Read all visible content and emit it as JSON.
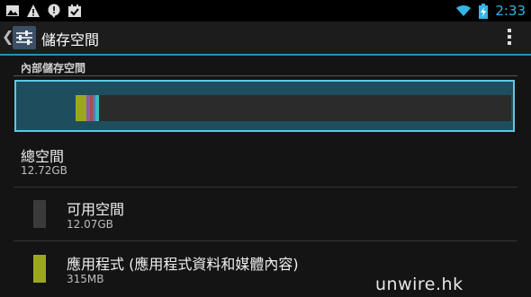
{
  "status_bar": {
    "time": "2:33",
    "icons_left": [
      "image-notification-icon",
      "warning-icon",
      "alert-icon",
      "download-done-icon"
    ],
    "icons_right": [
      "wifi-icon",
      "battery-charging-icon"
    ],
    "accent_color": "#33b5e5"
  },
  "action_bar": {
    "title": "儲存空間",
    "back_icon": "chevron-left-icon",
    "app_icon": "settings-sliders-icon",
    "menu_icon": "overflow-menu-icon"
  },
  "internal_storage": {
    "section_title": "內部儲存空間",
    "usage_bar": {
      "segments": [
        {
          "name": "apps",
          "color": "#9ba81c",
          "fraction": 0.025
        },
        {
          "name": "pictures-videos",
          "color": "#8b5ca8",
          "fraction": 0.008
        },
        {
          "name": "audio",
          "color": "#b04949",
          "fraction": 0.006
        },
        {
          "name": "downloads",
          "color": "#4d7fb5",
          "fraction": 0.006
        },
        {
          "name": "misc",
          "color": "#3fb8c0",
          "fraction": 0.008
        }
      ],
      "track_color": "#2b2b2b"
    }
  },
  "items": [
    {
      "title": "總空間",
      "value": "12.72GB"
    },
    {
      "title": "可用空間",
      "value": "12.07GB",
      "color": "#3a3a3a"
    },
    {
      "title": "應用程式 (應用程式資料和媒體內容)",
      "value": "315MB",
      "color": "#9ba81c"
    }
  ],
  "watermark": "unwire.hk"
}
